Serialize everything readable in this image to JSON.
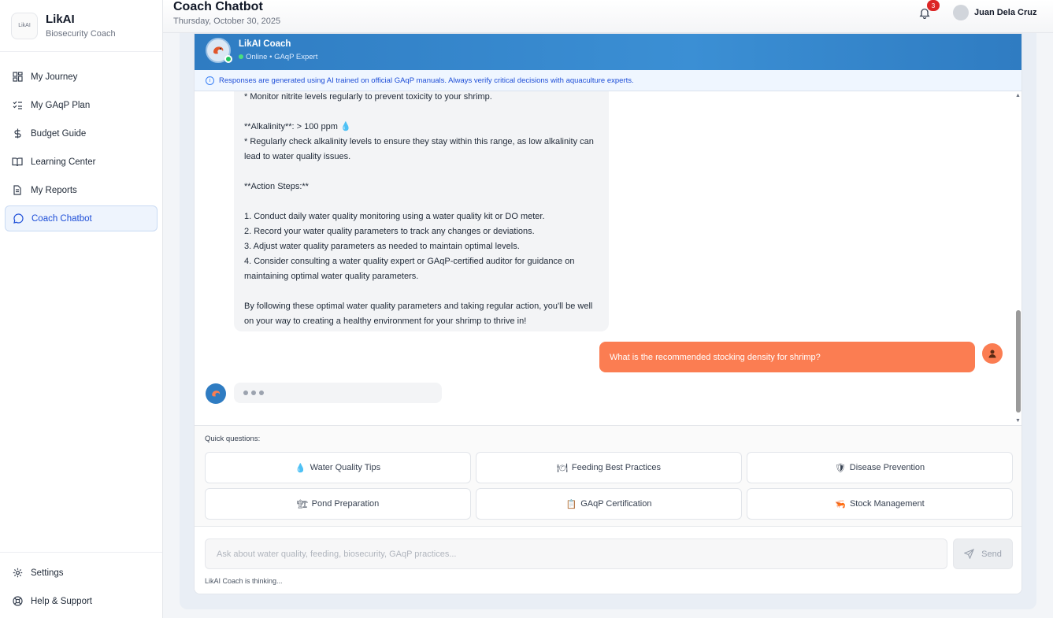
{
  "brand": {
    "name": "LikAI",
    "subtitle": "Biosecurity Coach",
    "logo_text": "LikAI"
  },
  "nav": [
    {
      "label": "My Journey",
      "icon": "grid-icon"
    },
    {
      "label": "My GAqP Plan",
      "icon": "checklist-icon"
    },
    {
      "label": "Budget Guide",
      "icon": "dollar-icon"
    },
    {
      "label": "Learning Center",
      "icon": "book-icon"
    },
    {
      "label": "My Reports",
      "icon": "document-icon"
    },
    {
      "label": "Coach Chatbot",
      "icon": "chat-icon",
      "active": true
    }
  ],
  "nav_bottom": [
    {
      "label": "Settings",
      "icon": "gear-icon"
    },
    {
      "label": "Help & Support",
      "icon": "lifebuoy-icon"
    }
  ],
  "header": {
    "title": "Coach Chatbot",
    "date": "Thursday, October 30, 2025",
    "notifications": "3",
    "user_name": "Juan Dela Cruz"
  },
  "chat": {
    "coach_name": "LikAI Coach",
    "status": "Online • GAqP Expert",
    "disclaimer": "Responses are generated using AI trained on official GAqP manuals. Always verify critical decisions with aquaculture experts.",
    "bot_message_lines": [
      "* Monitor nitrite levels regularly to prevent toxicity to your shrimp.",
      "",
      "**Alkalinity**: > 100 ppm 💧",
      "* Regularly check alkalinity levels to ensure they stay within this range, as low alkalinity can lead to water quality issues.",
      "",
      "**Action Steps:**",
      "",
      "1. Conduct daily water quality monitoring using a water quality kit or DO meter.",
      "2. Record your water quality parameters to track any changes or deviations.",
      "3. Adjust water quality parameters as needed to maintain optimal levels.",
      "4. Consider consulting a water quality expert or GAqP-certified auditor for guidance on maintaining optimal water quality parameters.",
      "",
      "By following these optimal water quality parameters and taking regular action, you'll be well on your way to creating a healthy environment for your shrimp to thrive in!"
    ],
    "user_message": "What is the recommended stocking density for shrimp?"
  },
  "quick": {
    "label": "Quick questions:",
    "items": [
      {
        "icon": "💧",
        "label": "Water Quality Tips"
      },
      {
        "icon": "🍽",
        "label": "Feeding Best Practices"
      },
      {
        "icon": "🛡",
        "label": "Disease Prevention"
      },
      {
        "icon": "🏗",
        "label": "Pond Preparation"
      },
      {
        "icon": "📋",
        "label": "GAqP Certification"
      },
      {
        "icon": "🦐",
        "label": "Stock Management"
      }
    ]
  },
  "input": {
    "placeholder": "Ask about water quality, feeding, biosecurity, GAqP practices...",
    "send_label": "Send",
    "status": "LikAI Coach is thinking..."
  }
}
